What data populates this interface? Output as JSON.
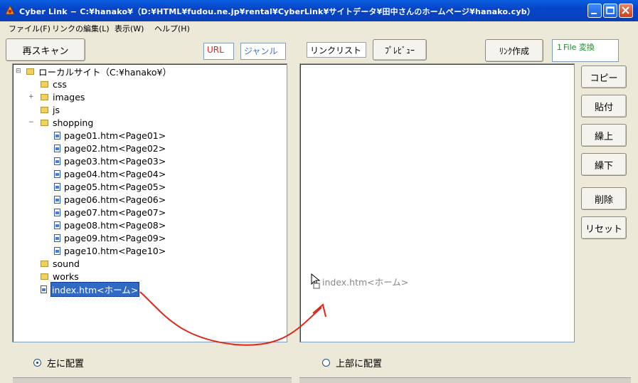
{
  "window": {
    "title": "Cyber Link − C:¥hanako¥（D:¥HTML¥fudou.ne.jp¥rental¥CyberLink¥サイトデータ¥田中さんのホームページ¥hanako.cyb）"
  },
  "menu": [
    "ファイル(F)",
    "リンクの編集(L)",
    "表示(W)",
    "ヘルプ(H)"
  ],
  "toolbar": {
    "rescan": "再スキャン",
    "url_tab": "URL",
    "genre_tab": "ジャンル",
    "linklist_label": "リンクリスト",
    "preview": "ﾌﾟﾚﾋﾞｭｰ",
    "create_link": "ﾘﾝｸ作成",
    "file_convert": "１File 変換"
  },
  "tree": {
    "root": "ローカルサイト（C:¥hanako¥）",
    "folders": [
      "css",
      "images",
      "js",
      "shopping"
    ],
    "pages": [
      "page01.htm<Page01>",
      "page02.htm<Page02>",
      "page03.htm<Page03>",
      "page04.htm<Page04>",
      "page05.htm<Page05>",
      "page06.htm<Page06>",
      "page07.htm<Page07>",
      "page08.htm<Page08>",
      "page09.htm<Page09>",
      "page10.htm<Page10>"
    ],
    "folders_after": [
      "sound",
      "works"
    ],
    "selected_file": "index.htm<ホーム>"
  },
  "linklist": {
    "drag_ghost": "index.htm<ホーム>"
  },
  "side_buttons": [
    "コピー",
    "貼付",
    "繰上",
    "繰下",
    "削除",
    "リセット"
  ],
  "bottom": {
    "radio_left": "左に配置",
    "radio_top": "上部に配置"
  },
  "colors": {
    "titlebar": "#0745C8",
    "accent_red": "#E0261A",
    "selection": "#316AC5",
    "url_text": "#E0261A",
    "genre_text": "#3A6FD8",
    "file_convert_text": "#1A8A2A"
  }
}
